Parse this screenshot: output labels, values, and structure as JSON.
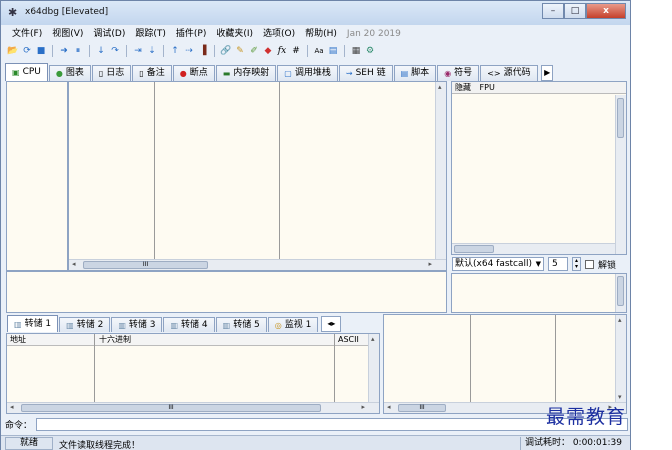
{
  "window": {
    "title": "x64dbg [Elevated]",
    "minimize": "–",
    "maximize": "□",
    "close": "x"
  },
  "menu": {
    "items": [
      "文件(F)",
      "视图(V)",
      "调试(D)",
      "跟踪(T)",
      "插件(P)",
      "收藏夹(I)",
      "选项(O)",
      "帮助(H)"
    ],
    "date": "Jan 20 2019"
  },
  "toolbar": {
    "icons": [
      "open-icon",
      "restart-icon",
      "stop-icon",
      "run-icon",
      "pause-icon",
      "step-into-icon",
      "step-over-icon",
      "trace-into-icon",
      "trace-over-icon",
      "execute-till-return-icon",
      "run-to-user-code-icon",
      "scylla-icon",
      "patch-icon",
      "comment-icon",
      "label-icon",
      "bookmark-icon",
      "function-icon",
      "hash-icon",
      "font-icon",
      "log-icon",
      "calculator-icon",
      "settings-icon"
    ],
    "glyphs": [
      "📂",
      "⟳",
      "■",
      "➜",
      "⏸",
      "↓",
      "↷",
      "⇥",
      "⇣",
      "↑",
      "⇢",
      "▐",
      "🔗",
      "✎",
      "✐",
      "◆",
      "fx",
      "#",
      "Aa",
      "▤",
      "▦",
      "⚙"
    ]
  },
  "tabs": [
    {
      "label": "CPU",
      "icon": "cpu-icon",
      "glyph": "▣"
    },
    {
      "label": "图表",
      "icon": "graph-icon",
      "glyph": "●"
    },
    {
      "label": "日志",
      "icon": "log-icon",
      "glyph": "▯"
    },
    {
      "label": "备注",
      "icon": "notes-icon",
      "glyph": "▯"
    },
    {
      "label": "断点",
      "icon": "breakpoint-icon",
      "glyph": "●"
    },
    {
      "label": "内存映射",
      "icon": "memory-map-icon",
      "glyph": "▬"
    },
    {
      "label": "调用堆栈",
      "icon": "call-stack-icon",
      "glyph": "▢"
    },
    {
      "label": "SEH 链",
      "icon": "seh-chain-icon",
      "glyph": "⇝"
    },
    {
      "label": "脚本",
      "icon": "script-icon",
      "glyph": "▤"
    },
    {
      "label": "符号",
      "icon": "symbols-icon",
      "glyph": "◉"
    },
    {
      "label": "源代码",
      "icon": "source-icon",
      "glyph": "<>"
    }
  ],
  "tab_scroll": "▶",
  "registers": {
    "hide_label": "隐藏",
    "fpu_label": "FPU"
  },
  "callconv": {
    "selected": "默认(x64 fastcall)",
    "arg_count": "5",
    "lock_label": "解锁"
  },
  "dump_tabs": [
    {
      "label": "转储 1",
      "icon": "dump-icon"
    },
    {
      "label": "转储 2",
      "icon": "dump-icon"
    },
    {
      "label": "转储 3",
      "icon": "dump-icon"
    },
    {
      "label": "转储 4",
      "icon": "dump-icon"
    },
    {
      "label": "转储 5",
      "icon": "dump-icon"
    },
    {
      "label": "监视 1",
      "icon": "watch-icon"
    }
  ],
  "dump_columns": {
    "address": "地址",
    "hex": "十六进制",
    "ascii": "ASCII"
  },
  "scrollbar": {
    "grip": "III",
    "left": "◂",
    "right": "▸",
    "up": "▴",
    "down": "▾"
  },
  "command": {
    "label": "命令："
  },
  "status": {
    "state": "就绪",
    "message": "文件读取线程完成！",
    "time": "调试耗时： 0:00:01:39"
  },
  "watermark": "最需教育"
}
